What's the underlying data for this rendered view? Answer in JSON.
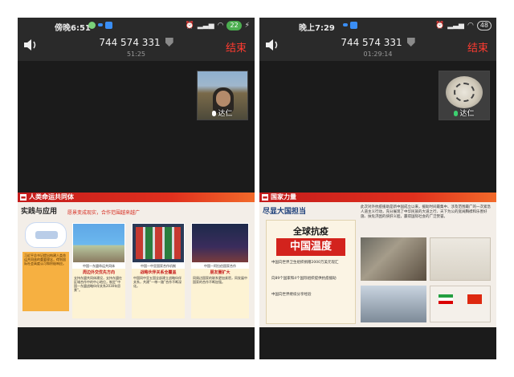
{
  "left": {
    "status": {
      "time": "傍晚6:51",
      "battery": "22"
    },
    "call": {
      "meeting_id": "744 574 331",
      "duration": "51:25",
      "end_label": "结束"
    },
    "participant": {
      "name": "达仁"
    },
    "slide": {
      "header": "人类命运共同体",
      "subtitle": "实践与应用",
      "tagline": "愿景变成现实，合作范围越来越广",
      "left_box": "习近平总书记提出构建人类命运共同体的重要理念，得到国际社会高度认可和积极响应。",
      "cards": [
        {
          "caption": "中国—东盟命运共同体",
          "title": "周边外交优先方向",
          "desc": "支持东盟共同体建设，支持东盟在区域合作中的中心地位，制定“中国—东盟战略伙伴关系2030年愿景”。"
        },
        {
          "caption": "中国—中亚国家合作机制",
          "title": "战略伙伴关系全覆盖",
          "desc": "中国同中亚五国全部建立战略伙伴关系，共建“一带一路”合作不断深化。"
        },
        {
          "caption": "中国—阿拉伯国家合作",
          "title": "朋友圈扩大",
          "desc": "同周边国家的联系更加紧密，同发展中国家的合作不断加强。"
        }
      ]
    }
  },
  "right": {
    "status": {
      "time": "晚上7:29",
      "battery": "48"
    },
    "call": {
      "meeting_id": "744 574 331",
      "duration": "01:29:14",
      "end_label": "结束"
    },
    "participant": {
      "name": "达仁"
    },
    "slide": {
      "header": "国家力量",
      "subtitle": "尽显大国担当",
      "intro": "此次对外抗疫援助是新中国成立以来，援助时间最集中、涉及范围最广的一次紧急人道主义行动，充分展现了中华民族的大道之行、天下为公的宽阔胸襟和乐善好施、扶危济困的侠肝义胆，赢得国际社会的广泛赞誉。",
      "poster_title": "全球抗疫",
      "poster_main": "中国温度",
      "stats": [
        "中国向世界卫生组织捐赠2000万美元现汇",
        "向89个国家和4个国际组织提供抗疫援助",
        "中国向世界继续分享经验"
      ]
    }
  }
}
